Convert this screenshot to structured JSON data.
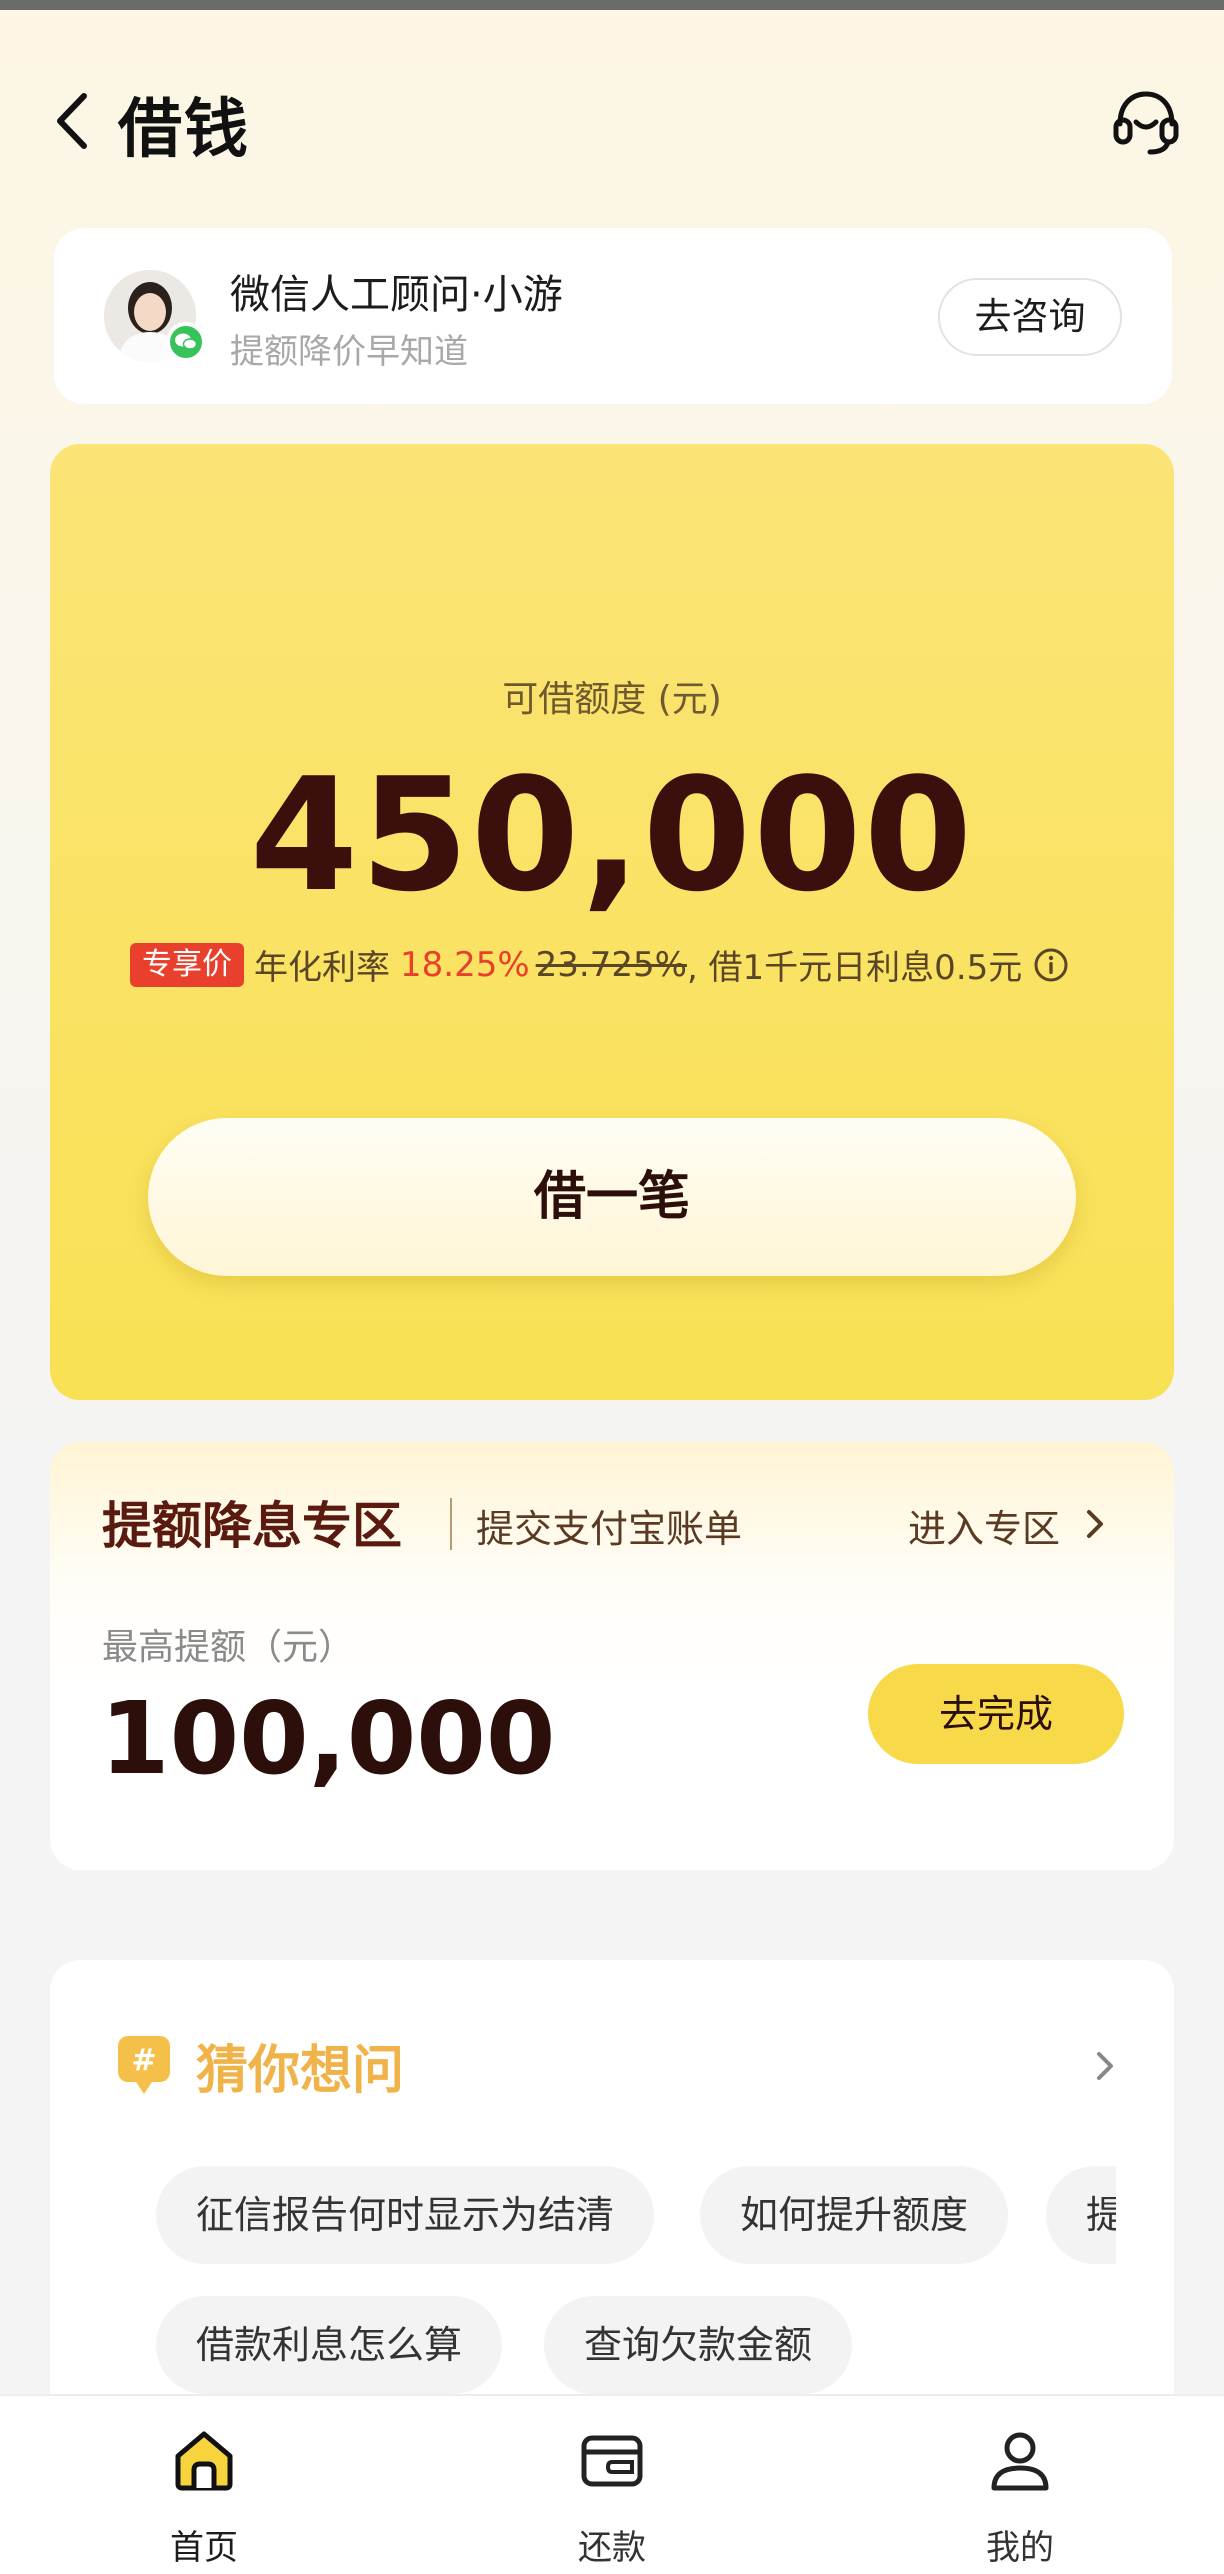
{
  "header": {
    "title": "借钱",
    "back_icon": "chevron-left-icon",
    "service_icon": "headset-icon"
  },
  "advisor": {
    "name": "微信人工顾问·小游",
    "subtitle": "提额降价早知道",
    "button": "去咨询",
    "avatar_icon": "advisor-avatar",
    "badge_icon": "wechat-icon"
  },
  "credit": {
    "label": "可借额度 (元)",
    "amount": "450,000",
    "promo_tag": "专享价",
    "rate_label": "年化利率",
    "rate_new": "18.25%",
    "rate_old": "23.725%",
    "rate_note": ", 借1千元日利息0.5元",
    "info_icon": "info-icon",
    "borrow_button": "借一笔"
  },
  "boost": {
    "title": "提额降息专区",
    "subtitle": "提交支付宝账单",
    "enter": "进入专区",
    "max_label": "最高提额（元）",
    "max_amount": "100,000",
    "complete_button": "去完成"
  },
  "faq": {
    "title": "猜你想问",
    "chips": [
      "征信报告何时显示为结清",
      "如何提升额度",
      "提前还款",
      "借款利息怎么算",
      "查询欠款金额"
    ]
  },
  "nav": {
    "items": [
      {
        "label": "首页",
        "icon": "home-icon"
      },
      {
        "label": "还款",
        "icon": "wallet-icon"
      },
      {
        "label": "我的",
        "icon": "user-icon"
      }
    ]
  },
  "colors": {
    "accent_yellow": "#f9e154",
    "dark_brown": "#3a0f0c",
    "promo_red": "#e8402c",
    "faq_orange": "#f0b34a"
  }
}
